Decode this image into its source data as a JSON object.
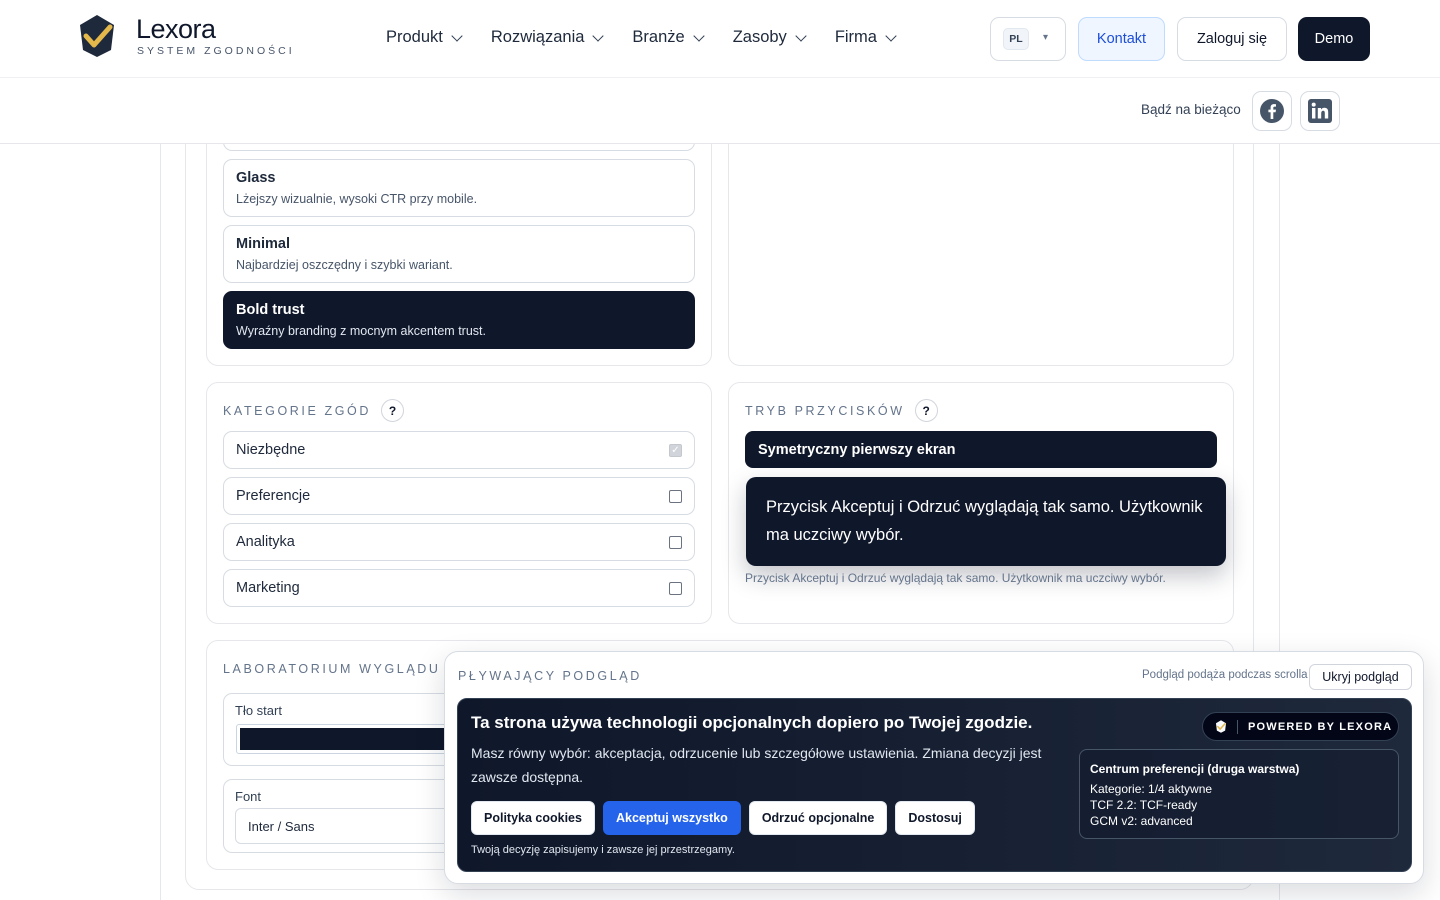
{
  "header": {
    "brand_name": "Lexora",
    "brand_tagline": "SYSTEM ZGODNOŚCI",
    "nav": [
      {
        "label": "Produkt"
      },
      {
        "label": "Rozwiązania"
      },
      {
        "label": "Branże"
      },
      {
        "label": "Zasoby"
      },
      {
        "label": "Firma"
      }
    ],
    "language": "PL",
    "language_caret": "▾",
    "contact_label": "Kontakt",
    "login_label": "Zaloguj się",
    "demo_label": "Demo"
  },
  "subbar": {
    "stay_updated": "Bądź na bieżąco",
    "social": [
      "facebook-icon",
      "linkedin-icon"
    ]
  },
  "styles": [
    {
      "title": "Glass",
      "desc": "Lżejszy wizualnie, wysoki CTR przy mobile."
    },
    {
      "title": "Minimal",
      "desc": "Najbardziej oszczędny i szybki wariant."
    },
    {
      "title": "Bold trust",
      "desc": "Wyraźny branding z mocnym akcentem trust.",
      "active": true
    }
  ],
  "categories": {
    "label": "KATEGORIE ZGÓD",
    "help": "?",
    "items": [
      {
        "label": "Niezbędne",
        "checked": true,
        "locked": true
      },
      {
        "label": "Preferencje",
        "checked": false
      },
      {
        "label": "Analityka",
        "checked": false
      },
      {
        "label": "Marketing",
        "checked": false
      }
    ]
  },
  "button_mode": {
    "label": "TRYB PRZYCISKÓW",
    "help": "?",
    "selected": "Symetryczny pierwszy ekran",
    "tooltip": "Przycisk Akceptuj i Odrzuć wyglądają tak samo. Użytkownik ma uczciwy wybór.",
    "note": "Przycisk Akceptuj i Odrzuć wyglądają tak samo. Użytkownik ma uczciwy wybór."
  },
  "lab": {
    "label": "LABORATORIUM WYGLĄDU",
    "help": "?",
    "bg_start_label": "Tło start",
    "bg_start_color": "#0f172a",
    "font_label": "Font",
    "font_value": "Inter / Sans"
  },
  "floating": {
    "title": "PŁYWAJĄCY PODGLĄD",
    "follow_note": "Podgląd podąża podczas scrolla",
    "hide_label": "Ukryj podgląd",
    "banner": {
      "title": "Ta strona używa technologii opcjonalnych dopiero po Twojej zgodzie.",
      "desc": "Masz równy wybór: akceptacja, odrzucenie lub szczegółowe ustawienia. Zmiana decyzji jest zawsze dostępna.",
      "buttons": {
        "policy": "Polityka cookies",
        "accept": "Akceptuj wszystko",
        "reject": "Odrzuć opcjonalne",
        "customize": "Dostosuj"
      },
      "note": "Twoją decyzję zapisujemy i zawsze jej przestrzegamy.",
      "powered": "POWERED BY LEXORA",
      "pref": {
        "title": "Centrum preferencji (druga warstwa)",
        "categories": "Kategorie: 1/4 aktywne",
        "tcf": "TCF 2.2: TCF-ready",
        "gcm": "GCM v2: advanced"
      }
    }
  },
  "colors": {
    "dark": "#0f172a",
    "accent_blue": "#2563eb",
    "logo_gold": "#e4b84a"
  }
}
